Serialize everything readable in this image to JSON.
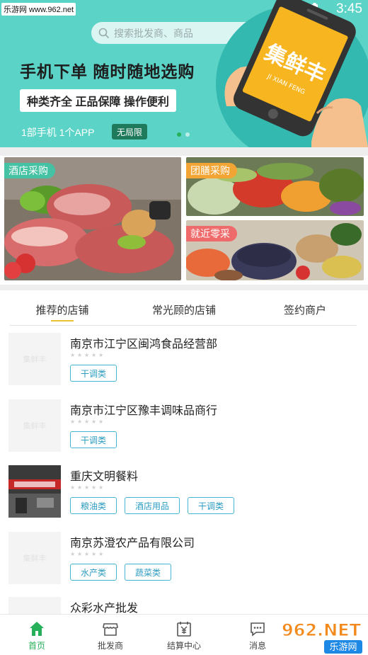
{
  "status_bar": {
    "site": "乐游网 www.962.net",
    "time": "3:45"
  },
  "search": {
    "placeholder": "搜索批发商、商品"
  },
  "banner": {
    "headline": "手机下单 随时随地选购",
    "subline": "种类齐全 正品保障 操作便利",
    "tagline": "1部手机 1个APP",
    "tag_chip": "无局限",
    "brand": "集鲜丰",
    "brand_pinyin": "JI XIAN FENG",
    "pages": 2,
    "active_page": 1
  },
  "categories": [
    {
      "label": "酒店采购",
      "color": "#45c2a4"
    },
    {
      "label": "团膳采购",
      "color": "#f2a535"
    },
    {
      "label": "就近零采",
      "color": "#ef6b6b"
    }
  ],
  "tabs": [
    {
      "label": "推荐的店铺",
      "active": true
    },
    {
      "label": "常光顾的店铺",
      "active": false
    },
    {
      "label": "签约商户",
      "active": false
    }
  ],
  "stores": [
    {
      "name": "南京市江宁区闽鸿食品经营部",
      "thumb_text": "集鲜丰",
      "rating": 0,
      "tags": [
        "干调类"
      ]
    },
    {
      "name": "南京市江宁区豫丰调味品商行",
      "thumb_text": "集鲜丰",
      "rating": 0,
      "tags": [
        "干调类"
      ]
    },
    {
      "name": "重庆文明餐料",
      "thumb_text": "",
      "rating": 0,
      "tags": [
        "粮油类",
        "酒店用品",
        "干调类"
      ]
    },
    {
      "name": "南京苏澄农产品有限公司",
      "thumb_text": "集鲜丰",
      "rating": 0,
      "tags": [
        "水产类",
        "蔬菜类"
      ]
    },
    {
      "name": "众彩水产批发",
      "thumb_text": "",
      "rating": 0,
      "tags": []
    }
  ],
  "bottom_nav": [
    {
      "label": "首页",
      "icon": "home-icon",
      "active": true
    },
    {
      "label": "批发商",
      "icon": "store-icon",
      "active": false
    },
    {
      "label": "结算中心",
      "icon": "settlement-icon",
      "active": false
    },
    {
      "label": "消息",
      "icon": "message-icon",
      "active": false
    }
  ],
  "watermark": {
    "text": "962.NET",
    "sub": "乐游网"
  },
  "colors": {
    "brand_green": "#27b05a",
    "banner_teal": "#5bd3c6",
    "chip_blue": "#48b4d4",
    "tab_underline": "#ecc12f"
  }
}
